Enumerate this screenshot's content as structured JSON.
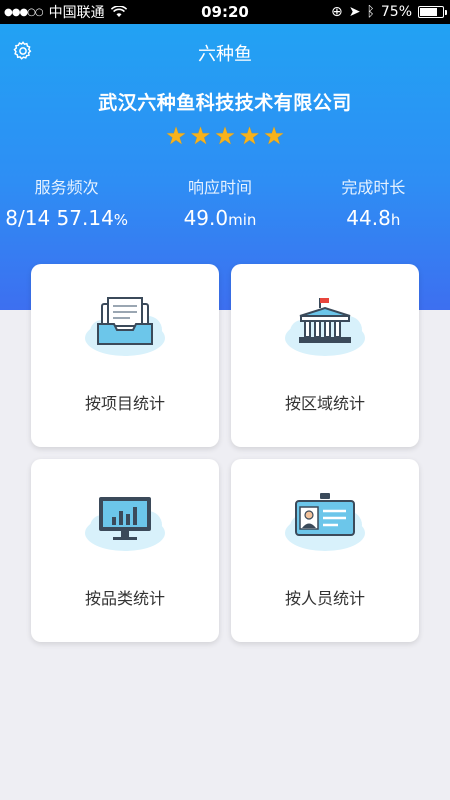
{
  "status_bar": {
    "carrier": "中国联通",
    "time": "09:20",
    "battery": "75%",
    "battery_level": 0.75
  },
  "header": {
    "settings_icon": "gear-icon",
    "title": "六种鱼",
    "company": "武汉六种鱼科技技术有限公司",
    "rating": 5,
    "stats": [
      {
        "label": "服务频次",
        "value": "8/14 57.14",
        "unit": "%"
      },
      {
        "label": "响应时间",
        "value": "49.0",
        "unit": "min"
      },
      {
        "label": "完成时长",
        "value": "44.8",
        "unit": "h"
      }
    ]
  },
  "cards": [
    {
      "label": "按项目统计",
      "icon": "inbox-documents-icon"
    },
    {
      "label": "按区域统计",
      "icon": "building-flag-icon"
    },
    {
      "label": "按品类统计",
      "icon": "monitor-chart-icon"
    },
    {
      "label": "按人员统计",
      "icon": "id-badge-icon"
    }
  ],
  "colors": {
    "header_top": "#22a2f3",
    "header_bottom": "#3d6ff0",
    "star": "#f7b21c",
    "background": "#eeeef3"
  }
}
